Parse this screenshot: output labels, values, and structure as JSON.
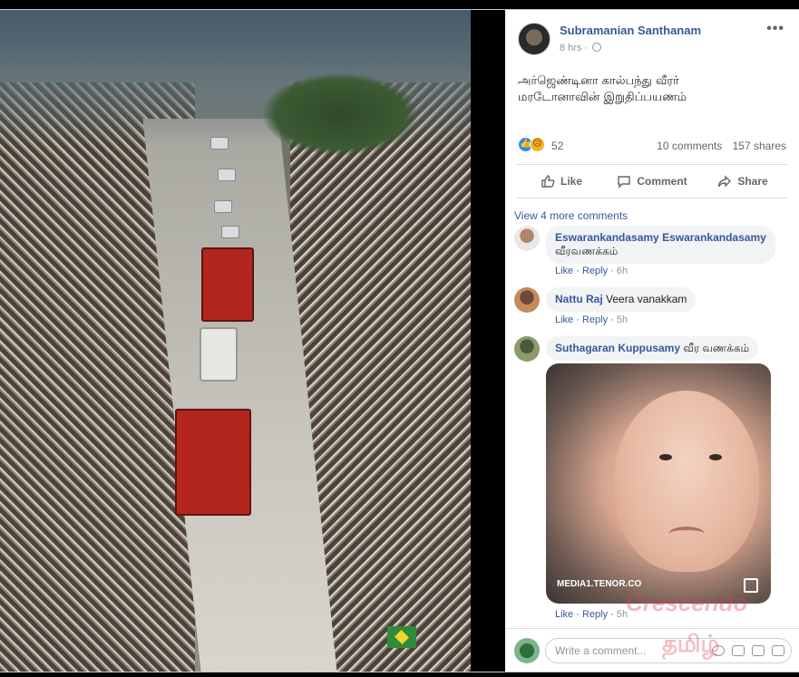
{
  "post": {
    "author": "Subramanian Santhanam",
    "time": "8 hrs",
    "text_line1": "அர்ஜெண்டினா கால்பந்து வீரர்",
    "text_line2": "மரடோனாவின் இறுதிப்பயணம்",
    "reaction_count": "52",
    "comments_count": "10 comments",
    "shares_count": "157 shares"
  },
  "actions": {
    "like": "Like",
    "comment": "Comment",
    "share": "Share"
  },
  "view_more": "View 4 more comments",
  "comments": [
    {
      "name": "Eswarankandasamy Eswarankandasamy",
      "text": "வீரவணக்கம்",
      "like": "Like",
      "reply": "Reply",
      "time": "6h"
    },
    {
      "name": "Nattu Raj",
      "text": "Veera vanakkam",
      "like": "Like",
      "reply": "Reply",
      "time": "5h"
    },
    {
      "name": "Suthagaran Kuppusamy",
      "text": "வீர வணக்கம்",
      "like": "Like",
      "reply": "Reply",
      "time": "5h"
    }
  ],
  "gif_label": "MEDIA1.TENOR.CO",
  "composer": {
    "placeholder": "Write a comment..."
  },
  "watermark": {
    "line1": "Crescendo",
    "line2": "தமிழ்"
  },
  "colors": {
    "link": "#385898",
    "like_blue": "#2d88ff",
    "sad_yellow": "#f7b125"
  }
}
